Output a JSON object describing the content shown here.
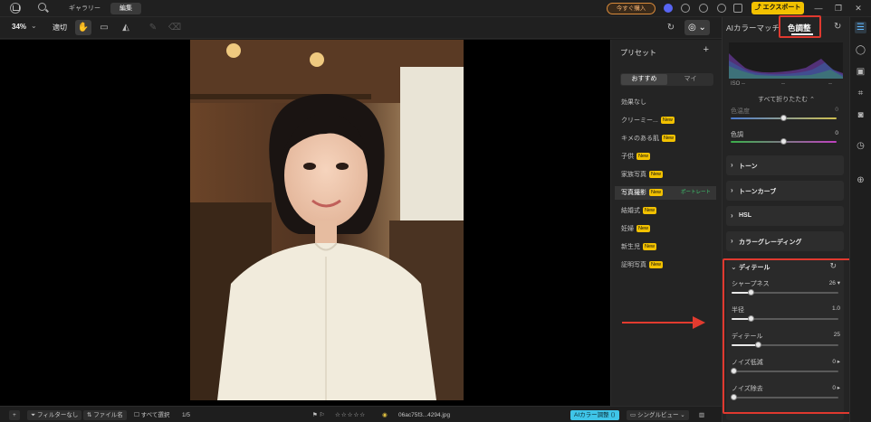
{
  "titlebar": {
    "tabs": [
      "ギャラリー",
      "編集"
    ],
    "active_tab": 1,
    "buy_label": "今すぐ購入",
    "export_label": "エクスポート"
  },
  "toolbar": {
    "zoom": "34%",
    "fit_label": "適切"
  },
  "presets": {
    "title": "プリセット",
    "seg_tabs": [
      "おすすめ",
      "マイ"
    ],
    "new_badge": "New",
    "portrait_badge": "ポートレート",
    "items": [
      {
        "label": "効果なし",
        "new": false
      },
      {
        "label": "クリーミー...",
        "new": true
      },
      {
        "label": "キメのある肌",
        "new": true
      },
      {
        "label": "子供",
        "new": true
      },
      {
        "label": "家族写真",
        "new": true
      },
      {
        "label": "写真撮影",
        "new": true,
        "selected": true,
        "portrait": true
      },
      {
        "label": "結婚式",
        "new": true
      },
      {
        "label": "妊婦",
        "new": true
      },
      {
        "label": "新生児",
        "new": true
      },
      {
        "label": "証明写真",
        "new": true
      }
    ]
  },
  "adjust": {
    "tab_ai": "AIカラーマッチ",
    "tab_color": "色調整",
    "iso_label": "ISO --",
    "iso_dash1": "--",
    "iso_dash2": "--",
    "collapse_all": "すべて折りたたむ ⌃",
    "partial_label": "色温度",
    "partial_value": "0",
    "tint_label": "色調",
    "tint_value": "0",
    "tint_pct": 0.5,
    "sections": [
      "トーン",
      "トーンカーブ",
      "HSL",
      "カラーグレーディング"
    ],
    "detail": {
      "title": "ディテール",
      "rows": [
        {
          "label": "シャープネス",
          "value": "26 ▾",
          "pct": 0.18
        },
        {
          "label": "半径",
          "value": "1.0",
          "pct": 0.18
        },
        {
          "label": "ディテール",
          "value": "25",
          "pct": 0.25
        },
        {
          "label": "ノイズ低減",
          "value": "0 ▸",
          "pct": 0.0
        },
        {
          "label": "ノイズ除去",
          "value": "0 ▸",
          "pct": 0.0
        }
      ]
    }
  },
  "filmbar": {
    "filter": "フィルターなし",
    "filename_sort": "ファイル名",
    "select_all": "すべて選択",
    "count": "1/5",
    "filename": "06ac75f3...4294.jpg",
    "ai_btn": "AIカラー調整",
    "view": "シングルビュー"
  }
}
